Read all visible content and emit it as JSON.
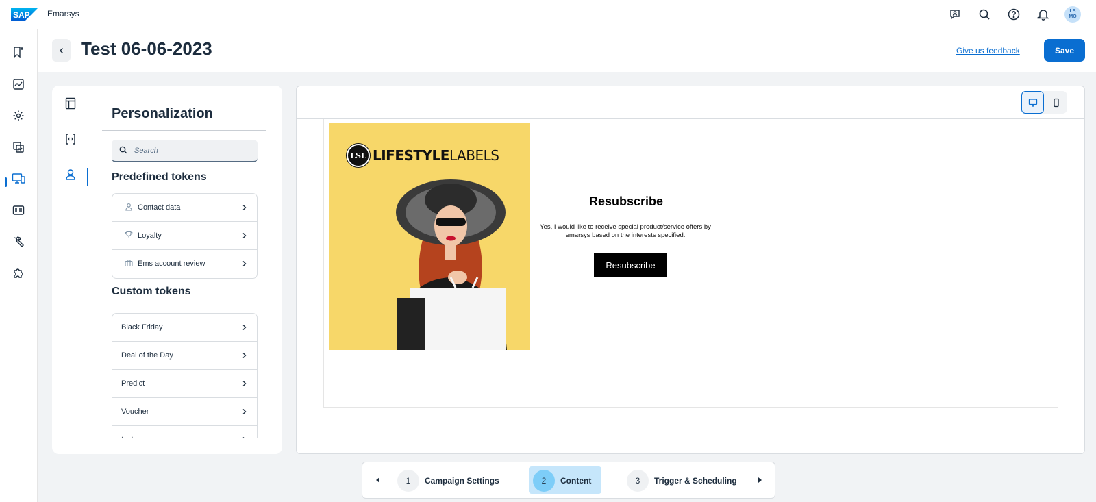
{
  "app": {
    "logo_text": "SAP",
    "name": "Emarsys"
  },
  "topbar": {
    "icons": [
      "feedback-chat-icon",
      "search-icon",
      "help-icon",
      "notification-bell-icon"
    ],
    "avatar_initials_line1": "LS",
    "avatar_initials_line2": "MO"
  },
  "leftnav": {
    "items": [
      "campaigns-icon",
      "analytics-icon",
      "automation-icon",
      "assets-icon",
      "channels-icon",
      "contacts-icon",
      "tools-icon",
      "add-ons-icon"
    ],
    "active_index": 4
  },
  "header": {
    "title": "Test 06-06-2023",
    "feedback_label": "Give us feedback",
    "save_label": "Save"
  },
  "panel": {
    "rail_icons": [
      "layout-icon",
      "code-block-icon",
      "person-icon"
    ],
    "title": "Personalization",
    "search_placeholder": "Search",
    "predefined_heading": "Predefined tokens",
    "predefined_tokens": [
      {
        "label": "Contact data",
        "icon": "person-icon"
      },
      {
        "label": "Loyalty",
        "icon": "trophy-icon"
      },
      {
        "label": "Ems account review",
        "icon": "briefcase-icon"
      }
    ],
    "custom_heading": "Custom tokens",
    "custom_tokens": [
      "Black Friday",
      "Deal of the Day",
      "Predict",
      "Voucher",
      "test"
    ]
  },
  "editor": {
    "view_modes": [
      "desktop-view-icon",
      "mobile-view-icon"
    ],
    "active_view": "desktop",
    "email": {
      "brand_badge": "LSL",
      "brand_bold": "LIFESTYLE",
      "brand_light": "LABELS",
      "heading": "Resubscribe",
      "body": "Yes, I would like to receive special product/service offers by emarsys based on the interests specified.",
      "button_label": "Resubscribe"
    }
  },
  "stepper": {
    "steps": [
      {
        "number": "1",
        "label": "Campaign Settings"
      },
      {
        "number": "2",
        "label": "Content"
      },
      {
        "number": "3",
        "label": "Trigger & Scheduling"
      }
    ],
    "active_step": 2
  }
}
